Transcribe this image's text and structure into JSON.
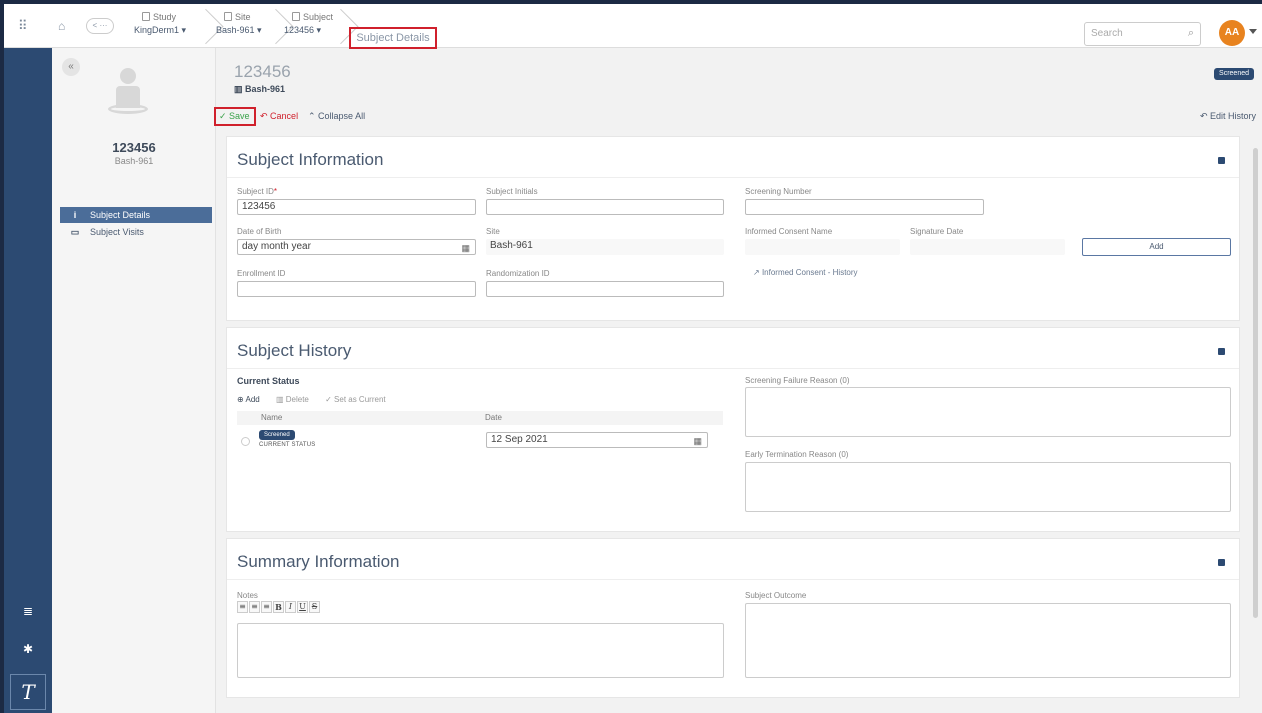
{
  "topbar": {
    "back_label": "< ···",
    "breadcrumbs": [
      {
        "label": "Study",
        "value": "KingDerm1"
      },
      {
        "label": "Site",
        "value": "Bash-961"
      },
      {
        "label": "Subject",
        "value": "123456"
      }
    ],
    "active_crumb": "Subject Details",
    "search_placeholder": "Search",
    "avatar_initials": "AA"
  },
  "sidebar": {
    "collapse_label": "«",
    "subject_id": "123456",
    "site": "Bash-961",
    "nav": [
      {
        "label": "Subject Details",
        "icon": "info-icon",
        "active": true
      },
      {
        "label": "Subject Visits",
        "icon": "briefcase-icon",
        "active": false
      }
    ]
  },
  "header": {
    "subject_id": "123456",
    "site": "Bash-961",
    "status": "Screened",
    "save_label": "Save",
    "cancel_label": "Cancel",
    "collapse_all_label": "Collapse All",
    "edit_history_label": "Edit History"
  },
  "subject_info": {
    "title": "Subject Information",
    "subject_id_label": "Subject ID",
    "subject_id_value": "123456",
    "initials_label": "Subject Initials",
    "initials_value": "",
    "screening_label": "Screening Number",
    "screening_value": "",
    "dob_label": "Date of Birth",
    "dob_value": "day month year",
    "site_label": "Site",
    "site_value": "Bash-961",
    "consent_name_label": "Informed Consent Name",
    "signature_date_label": "Signature Date",
    "add_label": "Add",
    "enrollment_label": "Enrollment ID",
    "enrollment_value": "",
    "randomization_label": "Randomization ID",
    "randomization_value": "",
    "consent_history_label": "Informed Consent - History"
  },
  "subject_history": {
    "title": "Subject History",
    "current_status_label": "Current Status",
    "tools": {
      "add": "Add",
      "delete": "Delete",
      "set_current": "Set as Current"
    },
    "columns": {
      "name": "Name",
      "date": "Date"
    },
    "rows": [
      {
        "status": "Screened",
        "caption": "CURRENT STATUS",
        "date": "12 Sep 2021"
      }
    ],
    "screening_failure_label": "Screening Failure Reason (0)",
    "early_termination_label": "Early Termination Reason (0)"
  },
  "summary": {
    "title": "Summary Information",
    "notes_label": "Notes",
    "outcome_label": "Subject Outcome"
  },
  "colors": {
    "rail": "#2c4a72",
    "accent_red": "#d0202c",
    "save_green": "#3aa24a",
    "avatar": "#e8831f"
  }
}
